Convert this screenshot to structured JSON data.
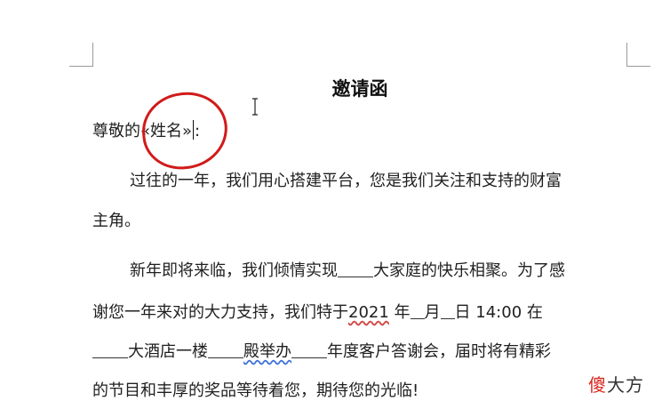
{
  "document": {
    "title": "邀请函",
    "greeting_prefix": "尊敬的",
    "merge_field": "«姓名»",
    "greeting_suffix": ":",
    "para1_line1": "过往的一年，我们用心搭建平台，您是我们关注和支持的财富",
    "para1_line2": "主角。",
    "para2_line1_a": "新年即将来临，我们倾情实现",
    "para2_line1_b": "大家庭的快乐相聚。为了感",
    "para2_line2_a": "谢您一年来对的大力支持，我们特于",
    "para2_line2_year": "2021",
    "para2_line2_b": " 年",
    "para2_line2_c": "月",
    "para2_line2_d": "日 14:00 在",
    "para2_line3_a": "大酒店一楼",
    "para2_line3_b": "殿举办",
    "para2_line3_c": "年度客户答谢会，届时将有精彩",
    "para2_line4": "的节目和丰厚的奖品等待着您，期待您的光临!"
  },
  "watermark": {
    "part1": "傻",
    "part2": "大方"
  },
  "colors": {
    "annotation": "#d11a1a",
    "spell_squiggle": "#3b6fd6"
  }
}
